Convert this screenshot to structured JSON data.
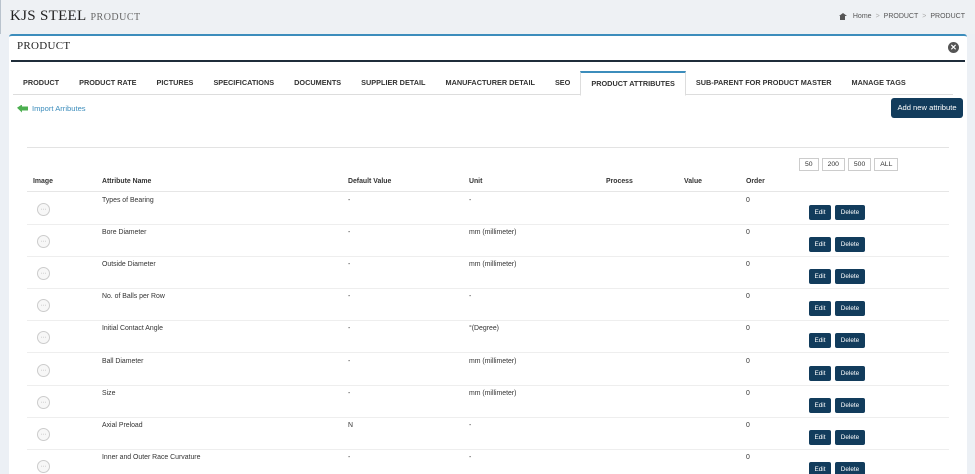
{
  "header": {
    "brand": "KJS STEEL",
    "section": "PRODUCT",
    "breadcrumb": [
      "Home",
      "PRODUCT",
      "PRODUCT"
    ]
  },
  "panel": {
    "title": "PRODUCT"
  },
  "tabs": [
    {
      "label": "PRODUCT"
    },
    {
      "label": "PRODUCT RATE"
    },
    {
      "label": "PICTURES"
    },
    {
      "label": "SPECIFICATIONS"
    },
    {
      "label": "DOCUMENTS"
    },
    {
      "label": "SUPPLIER DETAIL"
    },
    {
      "label": "MANUFACTURER DETAIL"
    },
    {
      "label": "SEO"
    },
    {
      "label": "PRODUCT ATTRIBUTES",
      "active": true
    },
    {
      "label": "SUB-PARENT FOR PRODUCT MASTER"
    },
    {
      "label": "MANAGE TAGS"
    }
  ],
  "actions": {
    "import_label": "Import Arributes",
    "add_label": "Add new attribute"
  },
  "pager": [
    "50",
    "200",
    "500",
    "ALL"
  ],
  "table": {
    "columns": [
      "Image",
      "Attribute Name",
      "Default Value",
      "Unit",
      "Process",
      "Value",
      "Order"
    ],
    "edit_label": "Edit",
    "delete_label": "Delete",
    "rows": [
      {
        "name": "Types of Bearing",
        "default": "-",
        "unit": "-",
        "order": "0"
      },
      {
        "name": "Bore Diameter",
        "default": "-",
        "unit": "mm (millimeter)",
        "order": "0"
      },
      {
        "name": "Outside Diameter",
        "default": "-",
        "unit": "mm (millimeter)",
        "order": "0"
      },
      {
        "name": "No. of Balls per Row",
        "default": "-",
        "unit": "-",
        "order": "0"
      },
      {
        "name": "Initial Contact Angle",
        "default": "-",
        "unit": "°(Degree)",
        "order": "0"
      },
      {
        "name": "Ball Diameter",
        "default": "-",
        "unit": "mm (millimeter)",
        "order": "0"
      },
      {
        "name": "Size",
        "default": "-",
        "unit": "mm (millimeter)",
        "order": "0"
      },
      {
        "name": "Axial Preload",
        "default": "N",
        "unit": "-",
        "order": "0"
      },
      {
        "name": "Inner and Outer Race Curvature",
        "default": "-",
        "unit": "-",
        "order": "0"
      }
    ]
  }
}
